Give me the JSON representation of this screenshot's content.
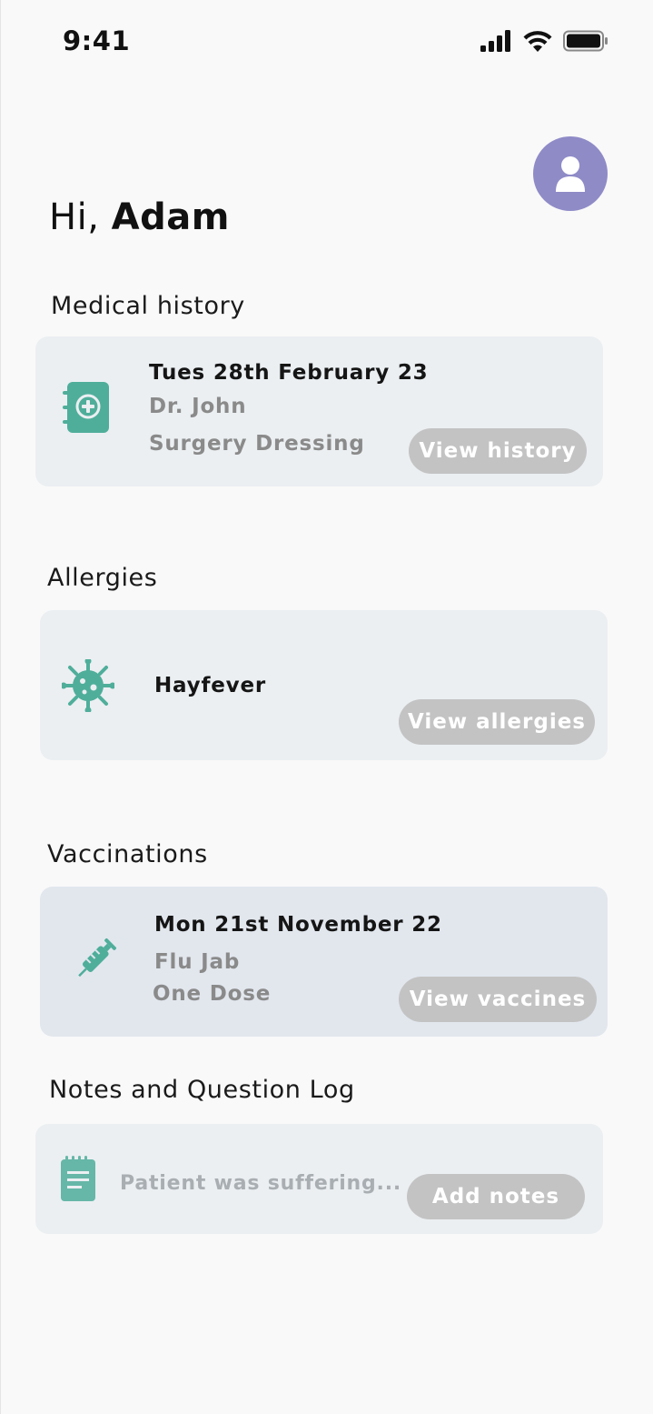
{
  "status_bar": {
    "time": "9:41",
    "icons": [
      "signal-icon",
      "wifi-icon",
      "battery-icon"
    ]
  },
  "header": {
    "greeting_prefix": "Hi, ",
    "user_name": "Adam",
    "avatar_icon": "user-icon",
    "avatar_color": "#8f8bc7"
  },
  "medical_history": {
    "title": "Medical history",
    "icon": "medical-book-icon",
    "date": "Tues 28th February 23",
    "doctor": "Dr. John",
    "procedure": "Surgery Dressing",
    "button_label": "View history"
  },
  "allergies": {
    "title": "Allergies",
    "icon": "virus-icon",
    "item": "Hayfever",
    "button_label": "View allergies"
  },
  "vaccinations": {
    "title": "Vaccinations",
    "icon": "syringe-icon",
    "date": "Mon 21st November 22",
    "vaccine": "Flu Jab",
    "dose": "One Dose",
    "button_label": "View vaccines"
  },
  "notes": {
    "title": "Notes and Question Log",
    "icon": "notepad-icon",
    "preview": "Patient was suffering...",
    "button_label": "Add notes"
  },
  "colors": {
    "accent_icon": "#4fae9a",
    "button_bg": "#c3c3c3",
    "card_bg": "#ebeff2"
  }
}
